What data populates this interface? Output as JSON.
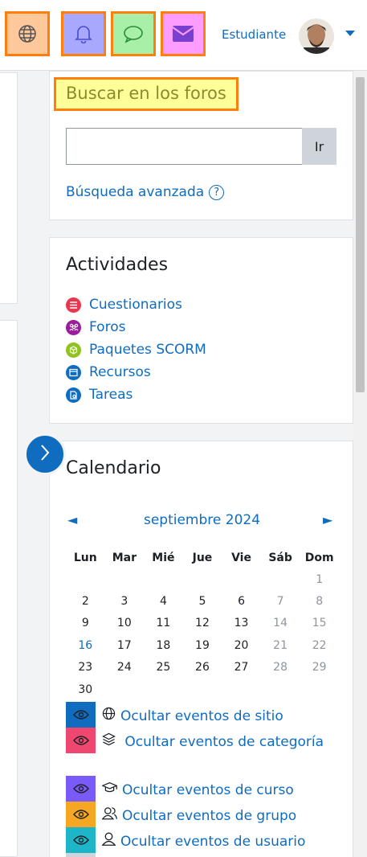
{
  "topbar": {
    "icons": [
      "globe-icon",
      "bell-icon",
      "chat-icon",
      "envelope-icon"
    ],
    "user_name": "Estudiante",
    "colors": {
      "globe_bg": "#ffc89a",
      "bell_bg": "#a8a8ff",
      "chat_bg": "#a8f0a8",
      "mail_bg": "#ff9cff",
      "highlight_border": "#ff7f0e"
    }
  },
  "search_block": {
    "title": "Buscar en los foros",
    "input_value": "",
    "go_label": "Ir",
    "advanced_label": "Búsqueda avanzada",
    "help_glyph": "?"
  },
  "activities_block": {
    "title": "Actividades",
    "items": [
      {
        "label": "Cuestionarios",
        "icon": "quiz-icon",
        "color": "#e8384f"
      },
      {
        "label": "Foros",
        "icon": "forum-icon",
        "color": "#9d1b9e"
      },
      {
        "label": "Paquetes SCORM",
        "icon": "scorm-icon",
        "color": "#8fc31f"
      },
      {
        "label": "Recursos",
        "icon": "resource-icon",
        "color": "#0f6cbf"
      },
      {
        "label": "Tareas",
        "icon": "assignment-icon",
        "color": "#0f6cbf"
      }
    ]
  },
  "calendar_block": {
    "title": "Calendario",
    "prev_glyph": "◄",
    "next_glyph": "►",
    "month": "septiembre 2024",
    "weekdays": [
      "Lun",
      "Mar",
      "Mié",
      "Jue",
      "Vie",
      "Sáb",
      "Dom"
    ],
    "weeks": [
      [
        "",
        "",
        "",
        "",
        "",
        "",
        "1"
      ],
      [
        "2",
        "3",
        "4",
        "5",
        "6",
        "7",
        "8"
      ],
      [
        "9",
        "10",
        "11",
        "12",
        "13",
        "14",
        "15"
      ],
      [
        "16",
        "17",
        "18",
        "19",
        "20",
        "21",
        "22"
      ],
      [
        "23",
        "24",
        "25",
        "26",
        "27",
        "28",
        "29"
      ],
      [
        "30",
        "",
        "",
        "",
        "",
        "",
        ""
      ]
    ],
    "today": "16",
    "event_toggles": [
      {
        "label": "Ocultar eventos de sitio",
        "icon": "globe-icon",
        "color": "#0f6cbf"
      },
      {
        "label": "Ocultar eventos de categoría",
        "icon": "layers-icon",
        "color": "#ef476f"
      },
      {
        "label": "Ocultar eventos de curso",
        "icon": "graduation-cap-icon",
        "color": "#7a5af8"
      },
      {
        "label": "Ocultar eventos de grupo",
        "icon": "group-icon",
        "color": "#f5a623"
      },
      {
        "label": "Ocultar eventos de usuario",
        "icon": "user-icon",
        "color": "#1fb5c9"
      }
    ]
  }
}
